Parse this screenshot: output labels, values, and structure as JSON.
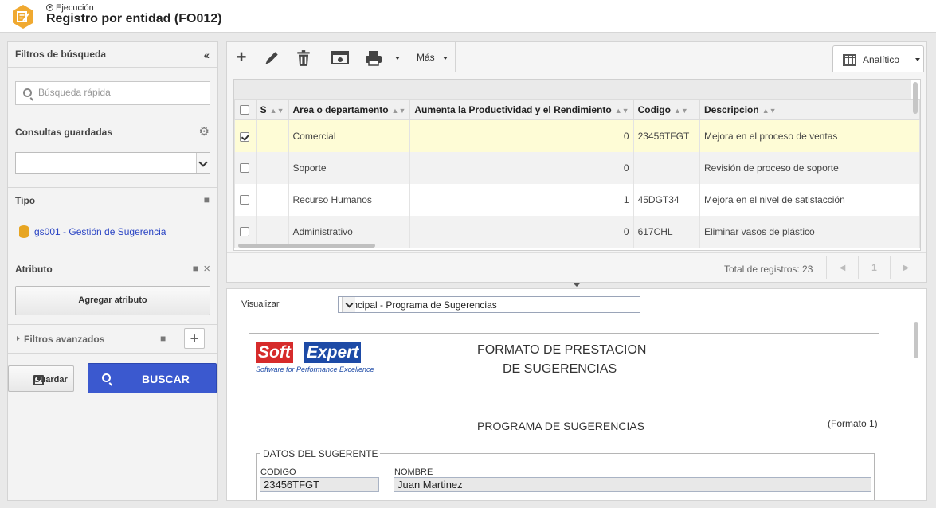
{
  "header": {
    "breadcrumb": "Ejecución",
    "title": "Registro por entidad (FO012)",
    "accent": "#f0a930"
  },
  "filters": {
    "title": "Filtros de búsqueda",
    "quick_search_placeholder": "Búsqueda rápida",
    "saved_queries_label": "Consultas guardadas",
    "saved_query_value": "",
    "type_label": "Tipo",
    "type_item": "gs001 - Gestión de Sugerencia",
    "attribute_label": "Atributo",
    "add_attribute_label": "Agregar atributo",
    "advanced_label": "Filtros avanzados",
    "save_label": "Guardar",
    "search_label": "BUSCAR"
  },
  "toolbar": {
    "more_label": "Más",
    "view_label": "Analítico"
  },
  "grid": {
    "columns": [
      "S",
      "Area o departamento",
      "Aumenta la Productividad y el Rendimiento",
      "Codigo",
      "Descripcion"
    ],
    "rows": [
      {
        "checked": true,
        "s": "",
        "area": "Comercial",
        "aumenta": "0",
        "codigo": "23456TFGT",
        "descripcion": "Mejora en el proceso de ventas"
      },
      {
        "checked": false,
        "s": "",
        "area": "Soporte",
        "aumenta": "0",
        "codigo": "",
        "descripcion": "Revisión de proceso de soporte"
      },
      {
        "checked": false,
        "s": "",
        "area": "Recurso Humanos",
        "aumenta": "1",
        "codigo": "45DGT34",
        "descripcion": "Mejora en el nivel de satistacción"
      },
      {
        "checked": false,
        "s": "",
        "area": "Administrativo",
        "aumenta": "0",
        "codigo": "617CHL",
        "descripcion": "Eliminar vasos de plástico"
      }
    ],
    "total_label": "Total de registros: 23",
    "page": "1"
  },
  "viewer": {
    "label": "Visualizar",
    "selected": "principal - Programa de Sugerencias",
    "doc": {
      "logo_soft": "Soft",
      "logo_expert": "Expert",
      "logo_tagline": "Software for Performance Excellence",
      "title_line1": "FORMATO DE PRESTACION",
      "title_line2": "DE SUGERENCIAS",
      "subtitle": "PROGRAMA DE SUGERENCIAS",
      "format": "(Formato 1)",
      "section": "DATOS DEL SUGERENTE",
      "code_label": "CODIGO",
      "code_value": "23456TFGT",
      "name_label": "NOMBRE",
      "name_value": "Juan Martinez"
    }
  }
}
